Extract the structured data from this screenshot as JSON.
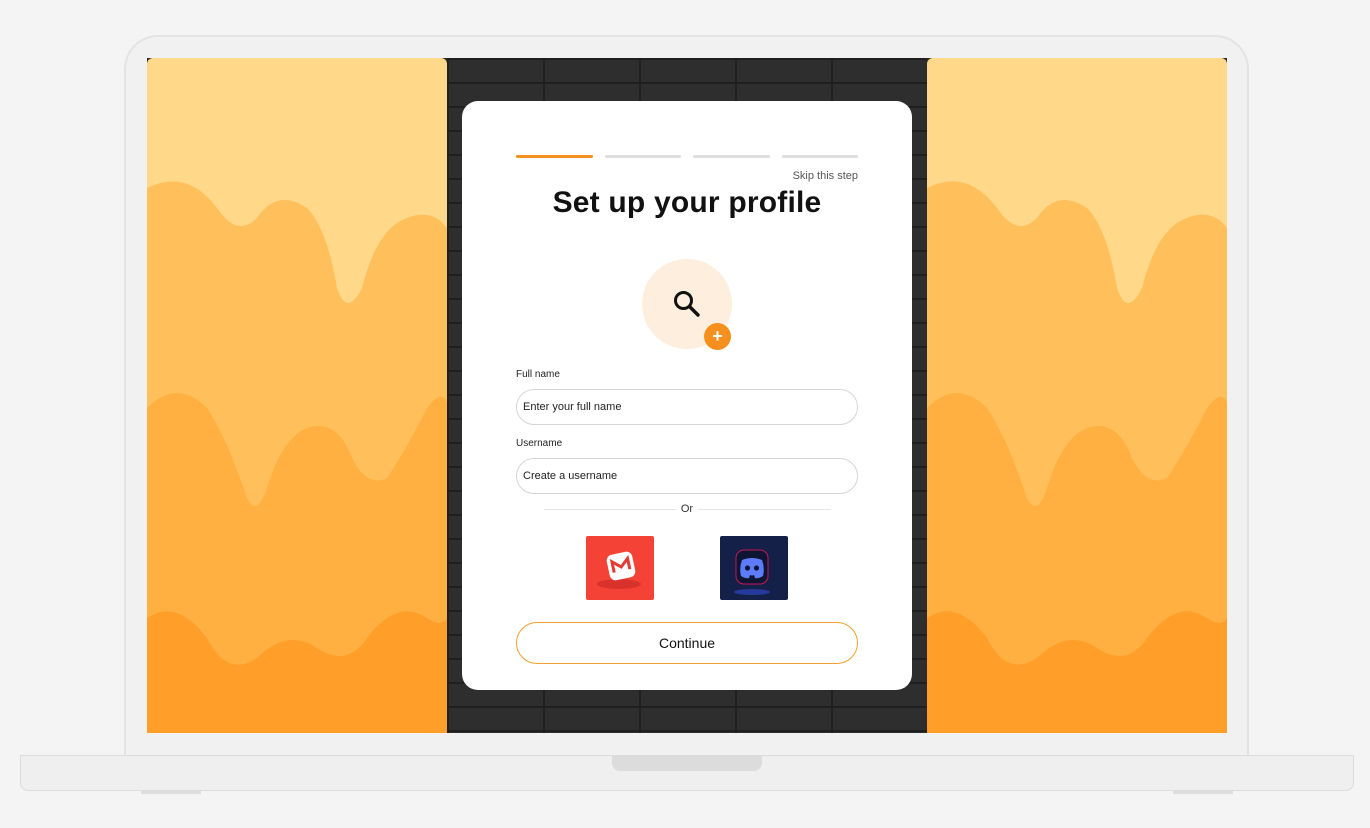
{
  "page": {
    "progress_steps": 4,
    "active_step": 1,
    "skip_label": "Skip this step",
    "title": "Set up your profile",
    "avatar_icon": "search-icon",
    "add_photo_icon": "plus-icon"
  },
  "form": {
    "full_name_label": "Full name",
    "full_name_placeholder": "Enter your full name",
    "username_label": "Username",
    "username_placeholder": "Create a username"
  },
  "divider": {
    "or_label": "Or"
  },
  "social": {
    "gmail_icon": "gmail-icon",
    "discord_icon": "discord-icon"
  },
  "actions": {
    "continue_label": "Continue"
  },
  "colors": {
    "accent": "#f5901e",
    "honey_light": "#ffd88a",
    "honey_dark": "#ff9f2a",
    "wall": "#2e2e2e",
    "gmail_bg": "#f44336",
    "discord_bg": "#152049"
  }
}
